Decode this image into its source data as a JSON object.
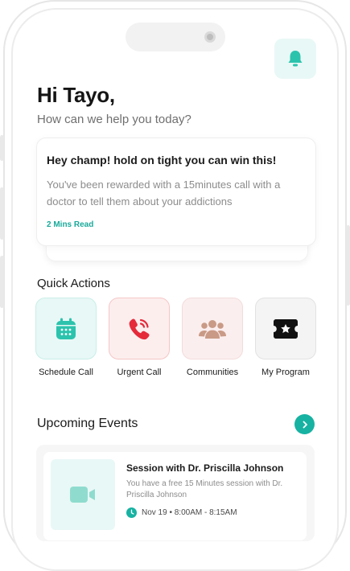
{
  "header": {
    "greeting": "Hi Tayo,",
    "subtitle": "How can we help you today?"
  },
  "promo_card": {
    "title": "Hey champ! hold on tight you can win this!",
    "body": "You've been rewarded with a 15minutes call with a doctor to tell them about your addictions",
    "link": "2 Mins Read"
  },
  "quick_actions": {
    "title": "Quick Actions",
    "items": [
      {
        "label": "Schedule Call",
        "icon": "calendar-icon",
        "bg": "#e8f8f6",
        "color": "#2cc3ad"
      },
      {
        "label": "Urgent Call",
        "icon": "phone-icon",
        "bg": "#fdeeee",
        "color": "#e52a3a"
      },
      {
        "label": "Communities",
        "icon": "people-icon",
        "bg": "#fbeeee",
        "color": "#c99a86"
      },
      {
        "label": "My Program",
        "icon": "ticket-icon",
        "bg": "#f4f4f4",
        "color": "#111111"
      }
    ]
  },
  "upcoming": {
    "title": "Upcoming Events",
    "event": {
      "title": "Session with Dr. Priscilla Johnson",
      "desc": "You have a free 15 Minutes session with Dr. Priscilla Johnson",
      "time": "Nov 19 • 8:00AM - 8:15AM",
      "icon": "video-icon"
    }
  },
  "colors": {
    "accent": "#17b2a2",
    "accent_light": "#e8f8f6"
  }
}
